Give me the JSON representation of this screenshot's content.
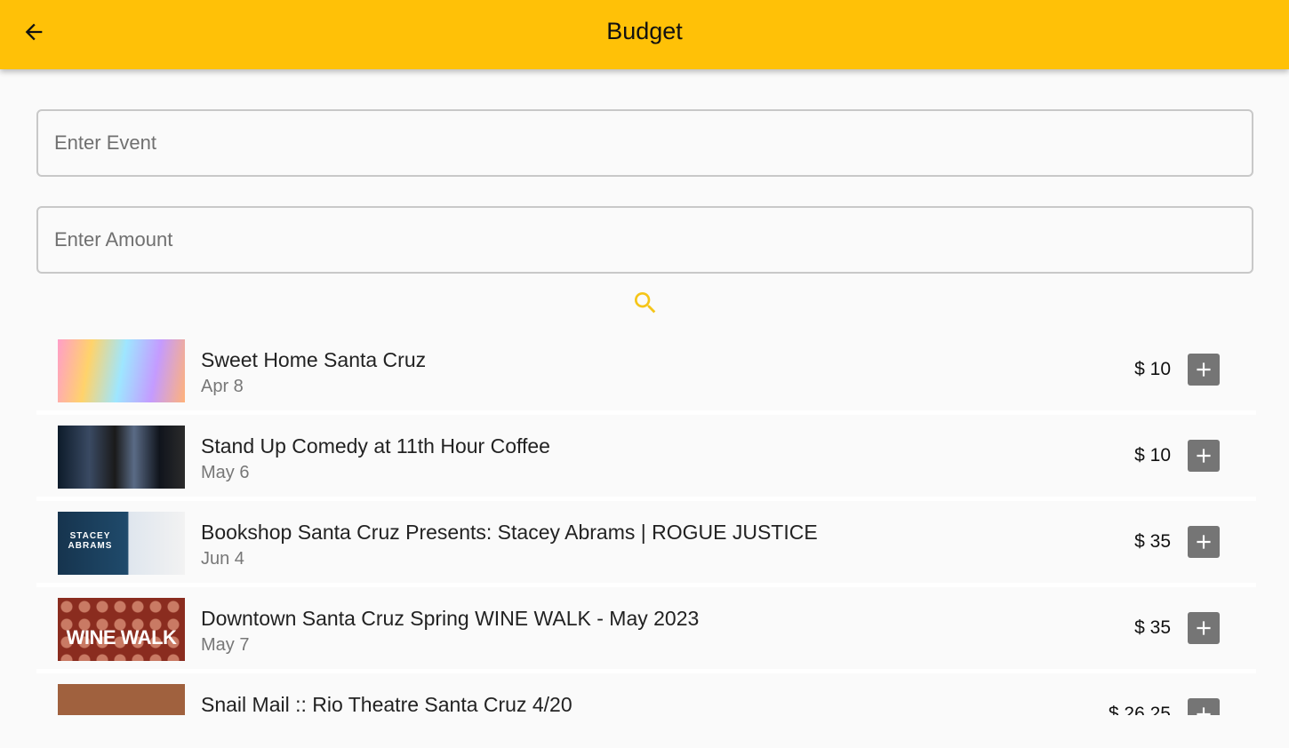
{
  "header": {
    "title": "Budget",
    "back_icon": "arrow-left-icon",
    "background": "#ffc107"
  },
  "form": {
    "event_placeholder": "Enter Event",
    "amount_placeholder": "Enter Amount",
    "search_icon": "search-icon",
    "search_color": "#f5c518"
  },
  "events": [
    {
      "title": "Sweet Home Santa Cruz",
      "date": "Apr 8",
      "price": "$ 10",
      "thumb_text": ""
    },
    {
      "title": "Stand Up Comedy at 11th Hour Coffee",
      "date": "May 6",
      "price": "$ 10",
      "thumb_text": ""
    },
    {
      "title": "Bookshop Santa Cruz Presents: Stacey Abrams | ROGUE JUSTICE",
      "date": "Jun 4",
      "price": "$ 35",
      "thumb_text": "STACEY ABRAMS"
    },
    {
      "title": "Downtown Santa Cruz Spring WINE WALK - May 2023",
      "date": "May 7",
      "price": "$ 35",
      "thumb_text": "WINE WALK"
    },
    {
      "title": "Snail Mail :: Rio Theatre Santa Cruz 4/20",
      "date": "",
      "price": "$ 26.25",
      "thumb_text": ""
    }
  ],
  "add_icon": "plus-box-icon"
}
